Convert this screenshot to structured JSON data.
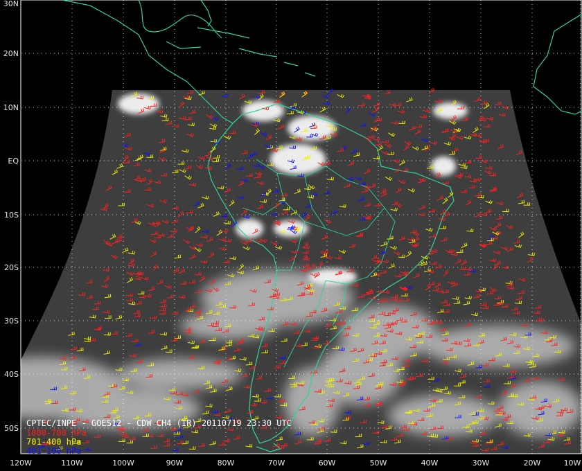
{
  "title": "CPTEC/INPE - GOES12 - CDW CH4 (IR) 20110719 23:30 UTC",
  "legend": [
    {
      "label": "1000-700 hPa",
      "color": "#ff2020"
    },
    {
      "label": "701-400 hPa",
      "color": "#f0f000"
    },
    {
      "label": "401-100 hPa",
      "color": "#1010ff"
    }
  ],
  "lat_labels": [
    "30N",
    "20N",
    "10N",
    "EQ",
    "10S",
    "20S",
    "30S",
    "40S",
    "50S"
  ],
  "lon_labels": [
    "120W",
    "110W",
    "100W",
    "90W",
    "80W",
    "70W",
    "60W",
    "50W",
    "40W",
    "30W",
    "20W",
    "10W"
  ],
  "colors": {
    "background": "#000000",
    "coastline": "#2fd49a",
    "grid": "#ffffff",
    "text": "#ffffff"
  }
}
